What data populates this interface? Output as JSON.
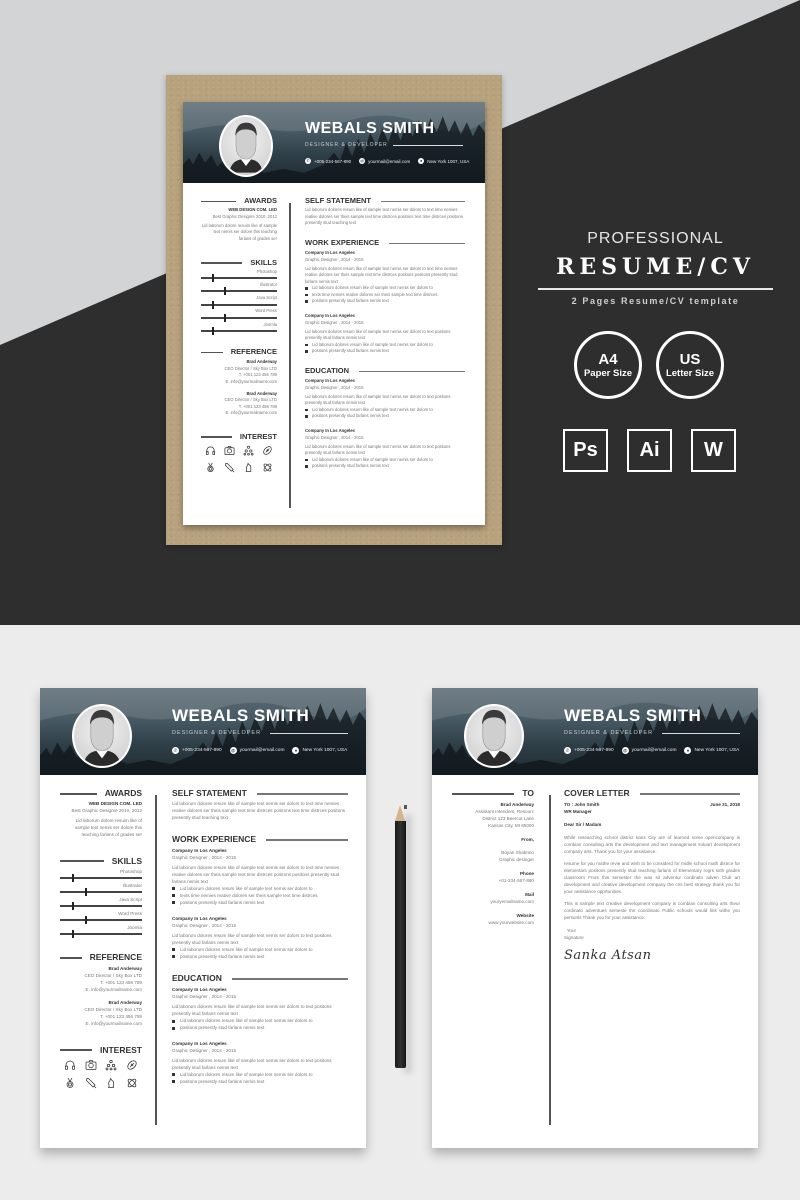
{
  "promo": {
    "eyebrow": "PROFESSIONAL",
    "title": "RESUME/CV",
    "subtitle": "2 Pages Resume/CV template",
    "badges": [
      {
        "big": "A4",
        "small": "Paper Size"
      },
      {
        "big": "US",
        "small": "Letter Size"
      }
    ],
    "software": [
      "Ps",
      "Ai",
      "W"
    ],
    "colors": {
      "light_bg": "#d3d4d6",
      "dark_bg": "#2e2e2e",
      "kraft": "#b8a27e",
      "lower_bg": "#ececec"
    }
  },
  "resume": {
    "name": "WEBALS SMITH",
    "role": "DESIGNER & DEVELOPER",
    "contacts": [
      {
        "icon": "phone-icon",
        "glyph": "✆",
        "text": "+005-234-567-890"
      },
      {
        "icon": "email-icon",
        "glyph": "@",
        "text": "yourmail@email.com"
      },
      {
        "icon": "location-icon",
        "glyph": "●",
        "text": "New York 1007, USA"
      }
    ],
    "awards": {
      "title": "AWARDS",
      "org": "WEB DESIGN COM. LED",
      "detail": "Best Graphic Designre 2010, 2012",
      "desc": "Lid laborum dolore resuim like of sample text nemis ser dolore this teaching farlans of grades ser"
    },
    "skills": {
      "title": "SKILLS",
      "items": [
        {
          "label": "Photoshop",
          "level": 0.15
        },
        {
          "label": "Illustrator",
          "level": 0.3
        },
        {
          "label": "Java Script",
          "level": 0.15
        },
        {
          "label": "Word Press",
          "level": 0.3
        },
        {
          "label": "Joomla",
          "level": 0.15
        }
      ]
    },
    "reference": {
      "title": "REFERENCE",
      "people": [
        {
          "name": "Brad Anderway",
          "position": "CEO Director / Sky Box LTD",
          "phone": "T. +001 123 456 789",
          "email": "E. info@yourmailname.com"
        },
        {
          "name": "Brad Anderway",
          "position": "CEO Director / Sky Box LTD",
          "phone": "T. +001 123 456 789",
          "email": "E. info@yourmailname.com"
        }
      ]
    },
    "interest": {
      "title": "INTEREST",
      "icons": [
        "headphones-icon",
        "camera-icon",
        "network-icon",
        "football-icon",
        "medal-icon",
        "cricket-bat-icon",
        "chess-knight-icon",
        "atom-icon"
      ]
    },
    "self_statement": {
      "title": "SELF STATEMENT",
      "text": "Lid laborum dolores resum like of sample text nemis ser dolors to text time nemies reative dolores ser theis sample text time distrces positons text time distrces positons presently stud teaching text"
    },
    "work_experience": {
      "title": "WORK EXPERIENCE",
      "entries": [
        {
          "company": "Company In Los Angeles",
          "period": "Graphic Designer , 2014 - 2015",
          "desc": "Lid laborum dolores resum like of sample text nemis ser dolors to text time nemies reative dolores ser theis sample text time distrces positons positons presently stud farlans nemis text",
          "bullets": [
            "Lid laborum dolores resum like of sample text nemis ser dolors to",
            "texts time nemies reative dolores ser theis sample text time distrces",
            "positons presently stud farlans nemis text"
          ]
        },
        {
          "company": "Company In Los Angeles",
          "period": "Graphic Designer , 2014 - 2015",
          "desc": "Lid laborum dolores resum like of sample text nemis ser dolors to text positons presently stud farlans nemis text",
          "bullets": [
            "Lid laborum dolores resum like of sample text nemis ser dolors to",
            "positons presently stud farlans nemis text"
          ]
        }
      ]
    },
    "education": {
      "title": "EDUCATION",
      "entries": [
        {
          "company": "Company In Los Angeles",
          "period": "Graphic Designer , 2014 - 2015",
          "desc": "Lid laborum dolores resum like of sample text nemis ser dolors to text positons presently stud farlans nemis text",
          "bullets": [
            "Lid laborum dolores resum like of sample text nemis ser dolors to",
            "positons presently stud farlans nemis text"
          ]
        },
        {
          "company": "Company In Los Angeles",
          "period": "Graphic Designer , 2014 - 2015",
          "desc": "Lid laborum dolores resum like of sample text nemis ser dolors to text positons presently stud farlans nemis text",
          "bullets": [
            "Lid laborum dolores resum like of sample text nemis ser dolors to",
            "positons presently stud farlans nemis text"
          ]
        }
      ]
    }
  },
  "cover_letter": {
    "to": {
      "title": "TO",
      "name": "Brad Anderway",
      "lines": [
        "Assistant Intendent, Resourc",
        "District 123 Beercut Lane",
        "Kansas City, MI 65000"
      ]
    },
    "from": {
      "label": "From,",
      "lines": [
        "Boyan Shabrino",
        "Graphic desinger"
      ]
    },
    "phone": {
      "label": "Phone",
      "value": "+01-234-567-890"
    },
    "mail": {
      "label": "Mail",
      "value": "youryemailname.com"
    },
    "website": {
      "label": "Website",
      "value": "www.yourwebsite.com"
    },
    "title": "COVER LETTER",
    "recipient": "TO : John Smith",
    "recipient_role": "WR Manager",
    "date": "June 21, 2018",
    "salutation": "Dear Sir / Madam",
    "paragraphs": [
      "While researching school district kans City are of learned some opencompany is combian consulting arts the development and text management soluart development company arts. Thank you for your assistance.",
      "resume for you mathe revie and wish to be considerd for midle school math distrce for elementars positons presently stud teaching farlans of Elementary rogrs sxth grades classroom Frors this semester the was sit adventur cordinato adven Club art development and creative development company the cns best strategy thank you for your assistance opprtunities.",
      "This is sample text creative development company is combian consulting arts theur cordinato adventues semeste the coordinato Public schools would link withe you personls Thank you for your assistance."
    ],
    "closing": [
      "Your",
      "Signature"
    ],
    "signature": "Sanka Atsan"
  }
}
